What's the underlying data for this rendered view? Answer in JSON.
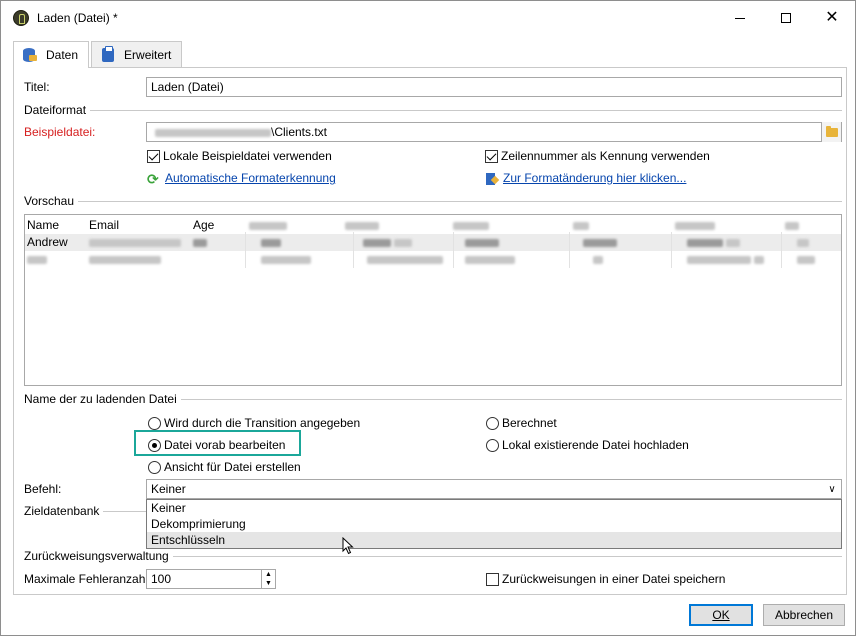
{
  "window": {
    "title": "Laden (Datei) *"
  },
  "tabs": [
    {
      "label": "Daten",
      "icon": "database-icon",
      "active": true
    },
    {
      "label": "Erweitert",
      "icon": "clipboard-icon",
      "active": false
    }
  ],
  "form": {
    "title_label": "Titel:",
    "title_value": "Laden (Datei)",
    "file_format_section": "Dateiformat",
    "sample_file_label": "Beispieldatei:",
    "sample_file_value": "\\Clients.txt",
    "use_local_sample": {
      "label": "Lokale Beispieldatei verwenden",
      "checked": true
    },
    "row_number_as_id": {
      "label": "Zeilennummer als Kennung verwenden",
      "checked": true
    },
    "auto_format_link": "Automatische Formaterkennung",
    "change_format_link": "Zur Formatänderung hier klicken..."
  },
  "preview": {
    "section": "Vorschau",
    "headers": [
      "Name",
      "Email",
      "Age"
    ],
    "rows": [
      [
        "Andrew"
      ],
      []
    ]
  },
  "file_name": {
    "section": "Name der zu ladenden Datei",
    "options": [
      {
        "label": "Wird durch die Transition angegeben",
        "checked": false
      },
      {
        "label": "Datei vorab bearbeiten",
        "checked": true
      },
      {
        "label": "Ansicht für Datei erstellen",
        "checked": false
      },
      {
        "label": "Berechnet",
        "checked": false
      },
      {
        "label": "Lokal existierende Datei hochladen",
        "checked": false
      }
    ]
  },
  "command": {
    "label": "Befehl:",
    "selected": "Keiner",
    "options": [
      "Keiner",
      "Dekomprimierung",
      "Entschlüsseln"
    ],
    "hovered": "Entschlüsseln"
  },
  "target_db": {
    "section": "Zieldatenbank"
  },
  "rejects": {
    "section": "Zurückweisungsverwaltung",
    "max_errors_label": "Maximale Fehleranzahl:",
    "max_errors_value": "100",
    "save_rejects": {
      "label": "Zurückweisungen in einer Datei speichern",
      "checked": false
    }
  },
  "buttons": {
    "ok": "OK",
    "cancel": "Abbrechen"
  },
  "colors": {
    "highlight": "#1ba79a",
    "link": "#0645ad",
    "required": "#d62020"
  }
}
